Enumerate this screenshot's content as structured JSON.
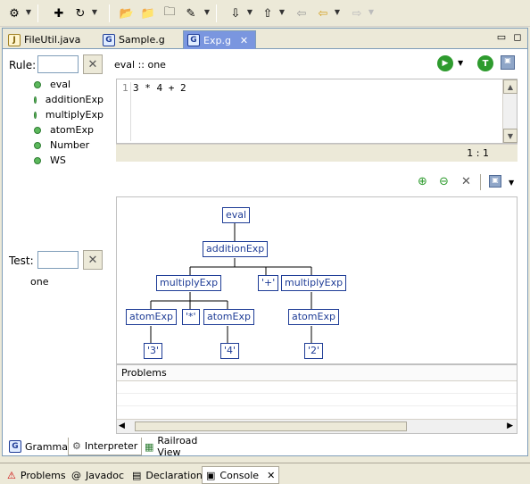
{
  "toolbar": {
    "icons": [
      "debug-run-icon",
      "new-icon",
      "run-icon",
      "open-folder-icon",
      "open-project-icon",
      "open-file-icon",
      "tool-icon",
      "next-annotation-icon",
      "prev-annotation-icon",
      "back-icon",
      "forward-icon"
    ]
  },
  "tabs": [
    {
      "label": "FileUtil.java"
    },
    {
      "label": "Sample.g"
    },
    {
      "label": "Exp.g"
    }
  ],
  "rule_panel": {
    "label": "Rule:",
    "filter_value": "",
    "items": [
      "eval",
      "additionExp",
      "multiplyExp",
      "atomExp",
      "Number",
      "WS"
    ]
  },
  "test_panel": {
    "label": "Test:",
    "filter_value": "",
    "items": [
      "one"
    ]
  },
  "interpreter": {
    "header": "eval :: one",
    "code_line_number": "1",
    "code": "3 * 4 + 2",
    "cursor_position": "1 : 1"
  },
  "tree": {
    "nodes": [
      "eval",
      "additionExp",
      "multiplyExp",
      "'+'",
      "multiplyExp",
      "atomExp",
      "'*'",
      "atomExp",
      "atomExp",
      "'3'",
      "'4'",
      "'2'"
    ]
  },
  "problems": {
    "title": "Problems"
  },
  "grammar_tabs": [
    {
      "label": "Grammar"
    },
    {
      "label": "Interpreter"
    },
    {
      "label": "Railroad View"
    }
  ],
  "view_tabs": [
    {
      "label": "Problems"
    },
    {
      "label": "Javadoc"
    },
    {
      "label": "Declaration"
    },
    {
      "label": "Console"
    }
  ],
  "colors": {
    "accent": "#7a96df",
    "tree_node": "#1e3c96",
    "run_green": "#2e9b2e"
  }
}
